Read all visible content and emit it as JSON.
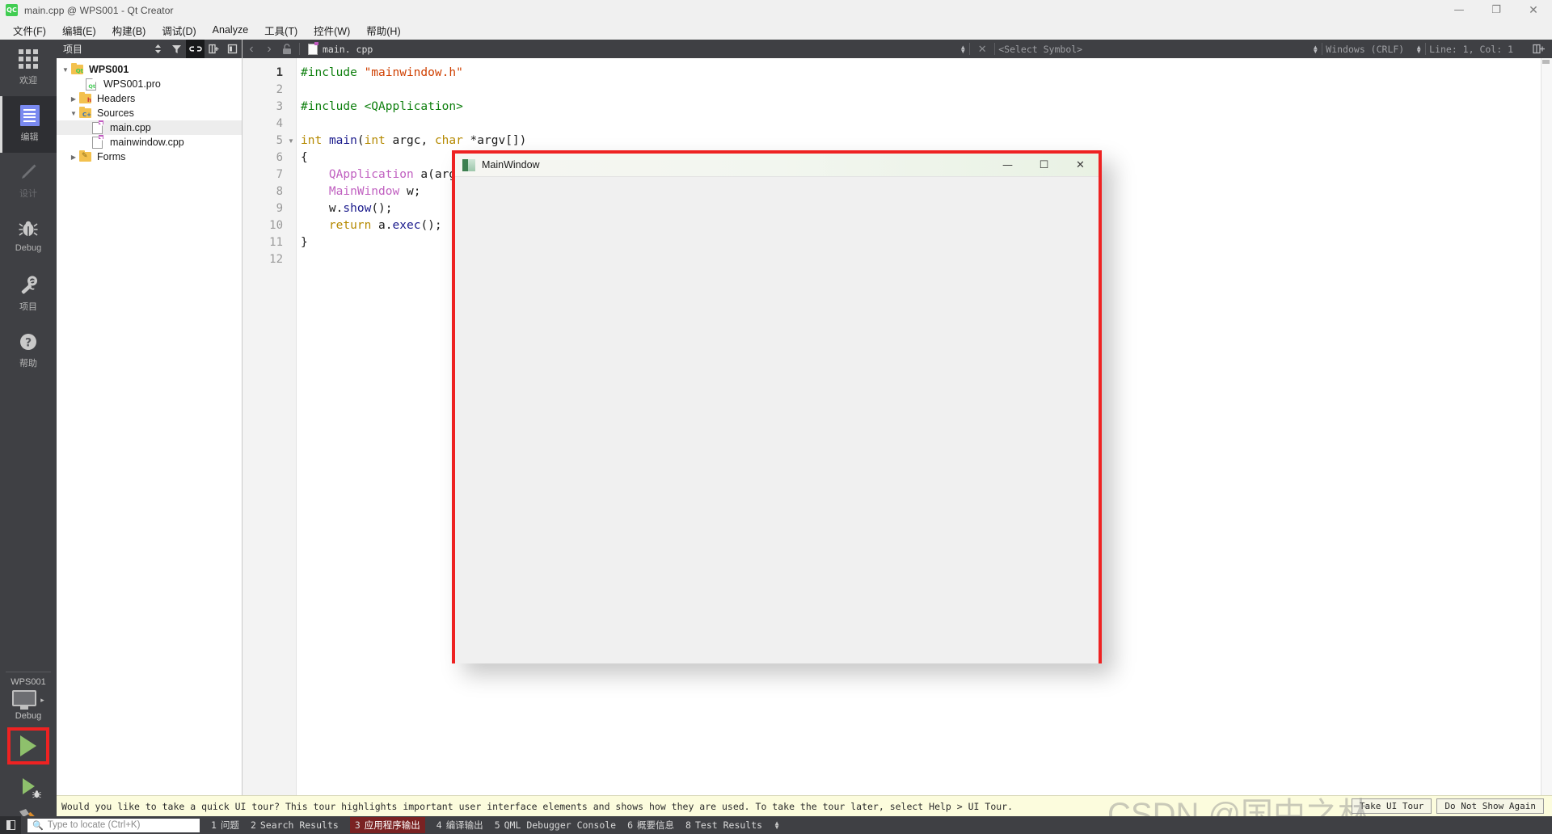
{
  "titlebar": {
    "logo": "qt-creator-logo",
    "title": "main.cpp @ WPS001 - Qt Creator",
    "minimize": "—",
    "restore": "❐",
    "close": "✕"
  },
  "menubar": {
    "items": [
      {
        "label": "文件(F)"
      },
      {
        "label": "编辑(E)"
      },
      {
        "label": "构建(B)"
      },
      {
        "label": "调试(D)"
      },
      {
        "label": "Analyze"
      },
      {
        "label": "工具(T)"
      },
      {
        "label": "控件(W)"
      },
      {
        "label": "帮助(H)"
      }
    ]
  },
  "modebar": {
    "items": [
      {
        "label": "欢迎",
        "icon": "grid-icon",
        "state": "normal"
      },
      {
        "label": "编辑",
        "icon": "edit-icon",
        "state": "active"
      },
      {
        "label": "设计",
        "icon": "pencil-icon",
        "state": "disabled"
      },
      {
        "label": "Debug",
        "icon": "bug-icon",
        "state": "normal"
      },
      {
        "label": "项目",
        "icon": "wrench-icon",
        "state": "normal"
      },
      {
        "label": "帮助",
        "icon": "question-icon",
        "state": "normal"
      }
    ],
    "kit_name": "WPS001",
    "kit_mode": "Debug",
    "kit_arrow": "▸",
    "run_button": "run-button",
    "debug_button": "start-debugging-button",
    "build_button": "build-button",
    "run_highlight_color": "#ee2222"
  },
  "project_panel": {
    "title": "项目",
    "header_icons": [
      {
        "name": "sort-icon",
        "glyph": "⇅"
      },
      {
        "name": "filter-icon",
        "glyph": "▼"
      },
      {
        "name": "link-with-editor-icon",
        "glyph": "⚭",
        "active": true
      },
      {
        "name": "split-icon",
        "glyph": "⊞"
      },
      {
        "name": "close-panel-icon",
        "glyph": "◧"
      }
    ],
    "tree": [
      {
        "label": "WPS001",
        "indent": 0,
        "arrow": "▼",
        "icon": "folder-qt",
        "badge": "Qt",
        "bold": true,
        "selected": false
      },
      {
        "label": "WPS001.pro",
        "indent": 1,
        "arrow": "",
        "icon": "file-pro",
        "badge": "Qt",
        "bold": false,
        "selected": false
      },
      {
        "label": "Headers",
        "indent": 1,
        "arrow": "▶",
        "icon": "folder-h",
        "badge": "h",
        "bold": false,
        "selected": false
      },
      {
        "label": "Sources",
        "indent": 1,
        "arrow": "▼",
        "icon": "folder-cpp",
        "badge": "C+",
        "bold": false,
        "selected": false
      },
      {
        "label": "main.cpp",
        "indent": 2,
        "arrow": "",
        "icon": "file-cpp",
        "badge": "",
        "bold": false,
        "selected": true
      },
      {
        "label": "mainwindow.cpp",
        "indent": 2,
        "arrow": "",
        "icon": "file-cpp",
        "badge": "",
        "bold": false,
        "selected": false
      },
      {
        "label": "Forms",
        "indent": 1,
        "arrow": "▶",
        "icon": "folder-ui",
        "badge": "",
        "bold": false,
        "selected": false
      }
    ]
  },
  "editor_toolbar": {
    "back": "‹",
    "forward": "›",
    "lock": "🔓",
    "file_name": "main. cpp",
    "close_file": "✕",
    "symbol_selector": "<Select Symbol>",
    "line_ending": "Windows (CRLF)",
    "cursor_position": "Line: 1, Col: 1",
    "split_icon": "split-editor-icon"
  },
  "code": {
    "lines": [
      {
        "n": "1",
        "fold": "",
        "tokens": [
          {
            "t": "#include",
            "c": "k-pre"
          },
          {
            "t": " ",
            "c": "k-pl"
          },
          {
            "t": "\"mainwindow.h\"",
            "c": "k-str"
          }
        ]
      },
      {
        "n": "2",
        "fold": "",
        "tokens": []
      },
      {
        "n": "3",
        "fold": "",
        "tokens": [
          {
            "t": "#include",
            "c": "k-pre"
          },
          {
            "t": " ",
            "c": "k-pl"
          },
          {
            "t": "<QApplication>",
            "c": "k-inc"
          }
        ]
      },
      {
        "n": "4",
        "fold": "",
        "tokens": []
      },
      {
        "n": "5",
        "fold": "▼",
        "tokens": [
          {
            "t": "int",
            "c": "k-kw"
          },
          {
            "t": " ",
            "c": "k-pl"
          },
          {
            "t": "main",
            "c": "k-fn"
          },
          {
            "t": "(",
            "c": "k-pl"
          },
          {
            "t": "int",
            "c": "k-kw"
          },
          {
            "t": " argc, ",
            "c": "k-pl"
          },
          {
            "t": "char",
            "c": "k-kw"
          },
          {
            "t": " *argv[])",
            "c": "k-pl"
          }
        ]
      },
      {
        "n": "6",
        "fold": "",
        "tokens": [
          {
            "t": "{",
            "c": "k-pl"
          }
        ]
      },
      {
        "n": "7",
        "fold": "",
        "tokens": [
          {
            "t": "    ",
            "c": "k-pl"
          },
          {
            "t": "QApplication",
            "c": "k-typ"
          },
          {
            "t": " a(argc, argv);",
            "c": "k-pl"
          }
        ]
      },
      {
        "n": "8",
        "fold": "",
        "tokens": [
          {
            "t": "    ",
            "c": "k-pl"
          },
          {
            "t": "MainWindow",
            "c": "k-typ"
          },
          {
            "t": " w;",
            "c": "k-pl"
          }
        ]
      },
      {
        "n": "9",
        "fold": "",
        "tokens": [
          {
            "t": "    w.",
            "c": "k-pl"
          },
          {
            "t": "show",
            "c": "k-fn"
          },
          {
            "t": "();",
            "c": "k-pl"
          }
        ]
      },
      {
        "n": "10",
        "fold": "",
        "tokens": [
          {
            "t": "    ",
            "c": "k-pl"
          },
          {
            "t": "return",
            "c": "k-kw"
          },
          {
            "t": " a.",
            "c": "k-pl"
          },
          {
            "t": "exec",
            "c": "k-fn"
          },
          {
            "t": "();",
            "c": "k-pl"
          }
        ]
      },
      {
        "n": "11",
        "fold": "",
        "tokens": [
          {
            "t": "}",
            "c": "k-pl"
          }
        ]
      },
      {
        "n": "12",
        "fold": "",
        "tokens": []
      }
    ],
    "current_line": "1"
  },
  "mainwindow_dialog": {
    "title": "MainWindow",
    "icon": "app-window-icon",
    "minimize": "—",
    "maximize": "☐",
    "close": "✕",
    "highlight_color": "#ee2222"
  },
  "notification": {
    "text": "Would you like to take a quick UI tour? This tour highlights important user interface elements and shows how they are used. To take the tour later, select Help > UI Tour.",
    "buttons": [
      {
        "label": "Take UI Tour"
      },
      {
        "label": "Do Not Show Again"
      }
    ]
  },
  "statusbar": {
    "toggle_sidebar": "toggle-sidebar-icon",
    "locator_placeholder": "Type to locate (Ctrl+K)",
    "search_icon": "search-icon",
    "panes": [
      {
        "num": "1",
        "label": "问题",
        "active": false
      },
      {
        "num": "2",
        "label": "Search Results",
        "active": false
      },
      {
        "num": "3",
        "label": "应用程序输出",
        "active": true
      },
      {
        "num": "4",
        "label": "编译输出",
        "active": false
      },
      {
        "num": "5",
        "label": "QML Debugger Console",
        "active": false
      },
      {
        "num": "6",
        "label": "概要信息",
        "active": false
      },
      {
        "num": "8",
        "label": "Test Results",
        "active": false
      }
    ],
    "active_pane_color": "#7a2222"
  },
  "watermark": {
    "text": "CSDN @国中之林"
  }
}
